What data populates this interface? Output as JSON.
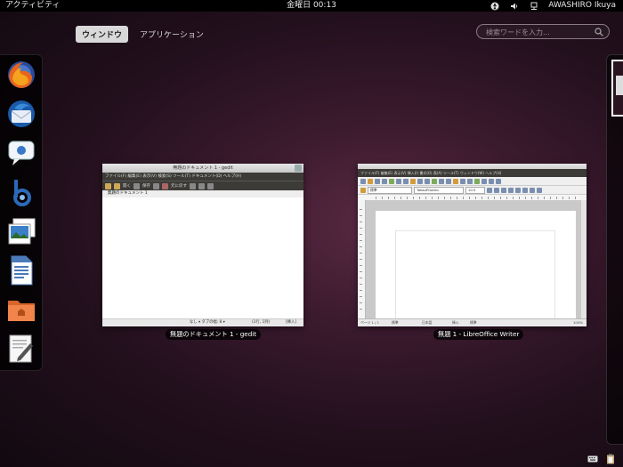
{
  "top_panel": {
    "activities": "アクティビティ",
    "clock": "金曜日 00:13",
    "user": "AWASHIRO Ikuya",
    "tray_icons": [
      "accessibility-icon",
      "volume-icon",
      "network-icon"
    ]
  },
  "view_selector": {
    "windows": "ウィンドウ",
    "applications": "アプリケーション",
    "selected": "ウィンドウ"
  },
  "search": {
    "placeholder": "検索ワードを入力..."
  },
  "dash": {
    "items": [
      {
        "name": "Firefox",
        "icon": "firefox-icon"
      },
      {
        "name": "Thunderbird",
        "icon": "thunderbird-icon"
      },
      {
        "name": "Empathy",
        "icon": "empathy-icon"
      },
      {
        "name": "Banshee",
        "icon": "banshee-icon"
      },
      {
        "name": "Shotwell",
        "icon": "shotwell-icon"
      },
      {
        "name": "LibreOffice Writer",
        "icon": "writer-icon"
      },
      {
        "name": "ホームフォルダー",
        "icon": "folder-icon"
      },
      {
        "name": "gedit",
        "icon": "text-editor-icon"
      }
    ]
  },
  "windows": {
    "gedit": {
      "title": "無題のドキュメント 1 - gedit",
      "caption": "無題のドキュメント 1 - gedit",
      "menu": "ファイル(F)  編集(E)  表示(V)  検索(S)  ツール(T)  ドキュメント(D)  ヘルプ(H)",
      "toolbar_open": "開く",
      "toolbar_save": "保存",
      "toolbar_undo": "元に戻す",
      "tab": "無題のドキュメント 1",
      "status_tab": "なし ▾  タブの幅: 8 ▾",
      "status_pos": "(1行, 1列)",
      "status_ins": "[挿入]"
    },
    "writer": {
      "caption": "無題 1 - LibreOffice Writer",
      "menu": "ファイル(F)  編集(E)  表示(V)  挿入(I)  書式(O)  表(A)  ツール(T)  ウィンドウ(W)  ヘルプ(H)",
      "style": "標準",
      "font": "TakaoPGothic",
      "size": "10.5",
      "status_page": "ページ 1 / 1",
      "status_std": "標準",
      "status_lang": "日本語",
      "status_ins": "挿入",
      "status_std2": "標準",
      "status_zoom": "100%"
    }
  },
  "bottom_tray": [
    "keyboard-icon",
    "clipboard-icon"
  ]
}
